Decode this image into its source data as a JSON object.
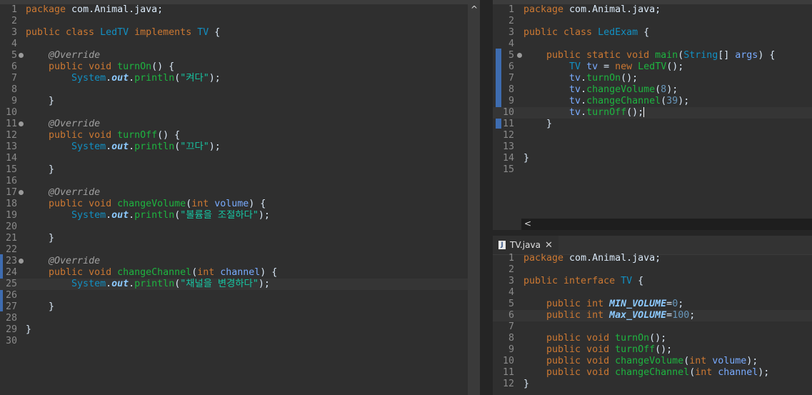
{
  "left_editor": {
    "lines": [
      [
        [
          "kw",
          "package"
        ],
        [
          "plain",
          " com.Animal.java;"
        ]
      ],
      [],
      [
        [
          "kw",
          "public class"
        ],
        [
          "plain",
          " "
        ],
        [
          "cls",
          "LedTV"
        ],
        [
          "plain",
          " "
        ],
        [
          "kw",
          "implements"
        ],
        [
          "plain",
          " "
        ],
        [
          "cls",
          "TV"
        ],
        [
          "plain",
          " {"
        ]
      ],
      [],
      [
        [
          "plain",
          "    "
        ],
        [
          "ann",
          "@Override"
        ]
      ],
      [
        [
          "plain",
          "    "
        ],
        [
          "kw",
          "public void"
        ],
        [
          "plain",
          " "
        ],
        [
          "mth",
          "turnOn"
        ],
        [
          "plain",
          "() {"
        ]
      ],
      [
        [
          "plain",
          "        "
        ],
        [
          "cls",
          "System"
        ],
        [
          "plain",
          "."
        ],
        [
          "fld",
          "out"
        ],
        [
          "plain",
          "."
        ],
        [
          "mth",
          "println"
        ],
        [
          "plain",
          "("
        ],
        [
          "str",
          "\"켜다\""
        ],
        [
          "plain",
          ");"
        ]
      ],
      [],
      [
        [
          "plain",
          "    }"
        ]
      ],
      [],
      [
        [
          "plain",
          "    "
        ],
        [
          "ann",
          "@Override"
        ]
      ],
      [
        [
          "plain",
          "    "
        ],
        [
          "kw",
          "public void"
        ],
        [
          "plain",
          " "
        ],
        [
          "mth",
          "turnOff"
        ],
        [
          "plain",
          "() {"
        ]
      ],
      [
        [
          "plain",
          "        "
        ],
        [
          "cls",
          "System"
        ],
        [
          "plain",
          "."
        ],
        [
          "fld",
          "out"
        ],
        [
          "plain",
          "."
        ],
        [
          "mth",
          "println"
        ],
        [
          "plain",
          "("
        ],
        [
          "str",
          "\"끄다\""
        ],
        [
          "plain",
          ");"
        ]
      ],
      [],
      [
        [
          "plain",
          "    }"
        ]
      ],
      [],
      [
        [
          "plain",
          "    "
        ],
        [
          "ann",
          "@Override"
        ]
      ],
      [
        [
          "plain",
          "    "
        ],
        [
          "kw",
          "public void"
        ],
        [
          "plain",
          " "
        ],
        [
          "mth",
          "changeVolume"
        ],
        [
          "plain",
          "("
        ],
        [
          "kw",
          "int"
        ],
        [
          "plain",
          " "
        ],
        [
          "var",
          "volume"
        ],
        [
          "plain",
          ") {"
        ]
      ],
      [
        [
          "plain",
          "        "
        ],
        [
          "cls",
          "System"
        ],
        [
          "plain",
          "."
        ],
        [
          "fld",
          "out"
        ],
        [
          "plain",
          "."
        ],
        [
          "mth",
          "println"
        ],
        [
          "plain",
          "("
        ],
        [
          "str",
          "\"볼륨을 조절하다\""
        ],
        [
          "plain",
          ");"
        ]
      ],
      [],
      [
        [
          "plain",
          "    }"
        ]
      ],
      [],
      [
        [
          "plain",
          "    "
        ],
        [
          "ann",
          "@Override"
        ]
      ],
      [
        [
          "plain",
          "    "
        ],
        [
          "kw",
          "public void"
        ],
        [
          "plain",
          " "
        ],
        [
          "mth",
          "changeChannel"
        ],
        [
          "plain",
          "("
        ],
        [
          "kw",
          "int"
        ],
        [
          "plain",
          " "
        ],
        [
          "var",
          "channel"
        ],
        [
          "plain",
          ") {"
        ]
      ],
      [
        [
          "plain",
          "        "
        ],
        [
          "cls",
          "System"
        ],
        [
          "plain",
          "."
        ],
        [
          "fld",
          "out"
        ],
        [
          "plain",
          "."
        ],
        [
          "mth",
          "println"
        ],
        [
          "plain",
          "("
        ],
        [
          "str",
          "\"채널을 변경하다\""
        ],
        [
          "plain",
          ");"
        ]
      ],
      [],
      [
        [
          "plain",
          "    }"
        ]
      ],
      [],
      [
        [
          "plain",
          "}"
        ]
      ],
      []
    ],
    "fold_lines": [
      5,
      11,
      17,
      23
    ],
    "current_line": 25,
    "scroll_up_arrow": "^"
  },
  "right_top_editor": {
    "lines": [
      [
        [
          "kw",
          "package"
        ],
        [
          "plain",
          " com.Animal.java;"
        ]
      ],
      [],
      [
        [
          "kw",
          "public class"
        ],
        [
          "plain",
          " "
        ],
        [
          "cls",
          "LedExam"
        ],
        [
          "plain",
          " {"
        ]
      ],
      [],
      [
        [
          "plain",
          "    "
        ],
        [
          "kw",
          "public static void"
        ],
        [
          "plain",
          " "
        ],
        [
          "mth",
          "main"
        ],
        [
          "plain",
          "("
        ],
        [
          "cls",
          "String"
        ],
        [
          "plain",
          "[] "
        ],
        [
          "var",
          "args"
        ],
        [
          "plain",
          ") {"
        ]
      ],
      [
        [
          "plain",
          "        "
        ],
        [
          "cls",
          "TV"
        ],
        [
          "plain",
          " "
        ],
        [
          "var",
          "tv"
        ],
        [
          "plain",
          " = "
        ],
        [
          "kw",
          "new"
        ],
        [
          "plain",
          " "
        ],
        [
          "mth",
          "LedTV"
        ],
        [
          "plain",
          "();"
        ]
      ],
      [
        [
          "plain",
          "        "
        ],
        [
          "var",
          "tv"
        ],
        [
          "plain",
          "."
        ],
        [
          "mth",
          "turnOn"
        ],
        [
          "plain",
          "();"
        ]
      ],
      [
        [
          "plain",
          "        "
        ],
        [
          "var",
          "tv"
        ],
        [
          "plain",
          "."
        ],
        [
          "mth",
          "changeVolume"
        ],
        [
          "plain",
          "("
        ],
        [
          "num",
          "8"
        ],
        [
          "plain",
          ");"
        ]
      ],
      [
        [
          "plain",
          "        "
        ],
        [
          "var",
          "tv"
        ],
        [
          "plain",
          "."
        ],
        [
          "mth",
          "changeChannel"
        ],
        [
          "plain",
          "("
        ],
        [
          "num",
          "39"
        ],
        [
          "plain",
          ");"
        ]
      ],
      [
        [
          "plain",
          "        "
        ],
        [
          "var",
          "tv"
        ],
        [
          "plain",
          "."
        ],
        [
          "mth",
          "turnOff"
        ],
        [
          "plain",
          "();"
        ]
      ],
      [
        [
          "plain",
          "    }"
        ]
      ],
      [],
      [],
      [
        [
          "plain",
          "}"
        ]
      ],
      []
    ],
    "fold_lines": [
      5
    ],
    "current_line": 10,
    "scroll_left_arrow": "<"
  },
  "right_bottom_editor": {
    "tab_label": "TV.java",
    "tab_icon_letter": "J",
    "tab_close": "✕",
    "lines": [
      [
        [
          "kw",
          "package"
        ],
        [
          "plain",
          " com.Animal.java;"
        ]
      ],
      [],
      [
        [
          "kw",
          "public interface"
        ],
        [
          "plain",
          " "
        ],
        [
          "cls",
          "TV"
        ],
        [
          "plain",
          " {"
        ]
      ],
      [],
      [
        [
          "plain",
          "    "
        ],
        [
          "kw",
          "public int"
        ],
        [
          "plain",
          " "
        ],
        [
          "cst",
          "MIN_VOLUME"
        ],
        [
          "plain",
          "="
        ],
        [
          "num",
          "0"
        ],
        [
          "plain",
          ";"
        ]
      ],
      [
        [
          "plain",
          "    "
        ],
        [
          "kw",
          "public int"
        ],
        [
          "plain",
          " "
        ],
        [
          "cst",
          "Max_VOLUME"
        ],
        [
          "plain",
          "="
        ],
        [
          "num",
          "100"
        ],
        [
          "plain",
          ";"
        ]
      ],
      [],
      [
        [
          "plain",
          "    "
        ],
        [
          "kw",
          "public void"
        ],
        [
          "plain",
          " "
        ],
        [
          "mth",
          "turnOn"
        ],
        [
          "plain",
          "();"
        ]
      ],
      [
        [
          "plain",
          "    "
        ],
        [
          "kw",
          "public void"
        ],
        [
          "plain",
          " "
        ],
        [
          "mth",
          "turnOff"
        ],
        [
          "plain",
          "();"
        ]
      ],
      [
        [
          "plain",
          "    "
        ],
        [
          "kw",
          "public void"
        ],
        [
          "plain",
          " "
        ],
        [
          "mth",
          "changeVolume"
        ],
        [
          "plain",
          "("
        ],
        [
          "kw",
          "int"
        ],
        [
          "plain",
          " "
        ],
        [
          "var",
          "volume"
        ],
        [
          "plain",
          ");"
        ]
      ],
      [
        [
          "plain",
          "    "
        ],
        [
          "kw",
          "public void"
        ],
        [
          "plain",
          " "
        ],
        [
          "mth",
          "changeChannel"
        ],
        [
          "plain",
          "("
        ],
        [
          "kw",
          "int"
        ],
        [
          "plain",
          " "
        ],
        [
          "var",
          "channel"
        ],
        [
          "plain",
          ");"
        ]
      ],
      [
        [
          "plain",
          "}"
        ]
      ]
    ],
    "current_line": 6
  }
}
